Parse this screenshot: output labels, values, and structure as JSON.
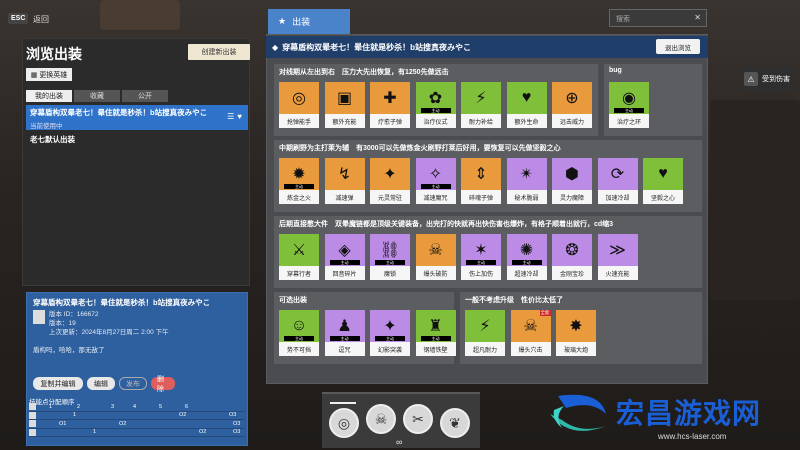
{
  "top_left": {
    "esc": "ESC",
    "back": "返回"
  },
  "left": {
    "title": "浏览出装",
    "create_btn": "创建新出装",
    "switch_hero": "更换英雄",
    "tabs": [
      "我的出装",
      "收藏",
      "公开"
    ],
    "active_loadout": {
      "title": "穿幕盾构双晕老七！晕住就是秒杀！b站搜真夜みやこ",
      "status": "当前使用中"
    },
    "default_loadout": "老七默认出装"
  },
  "detail": {
    "title": "穿幕盾构双晕老七！晕住就是秒杀！b站搜真夜みやこ",
    "meta": [
      "版本 ID：166672",
      "版本：19",
      "上次更新：2024年8月27日周二 2:00 下午"
    ],
    "desc": "盾构吗，哈哈，那无敌了",
    "buttons": {
      "copy_edit": "复制并编辑",
      "edit": "编辑",
      "publish": "发布",
      "delete": "删除"
    },
    "skill_order_label": "技能点分配顺序",
    "skill_rows": [
      {
        "marks": [
          "1",
          "2",
          "3",
          "4",
          "5",
          "6"
        ]
      },
      {
        "marks": [
          "1",
          "O2",
          "O3"
        ]
      },
      {
        "marks": [
          "O1",
          "O2",
          "O3"
        ]
      },
      {
        "marks": [
          "1",
          "O2",
          "O3"
        ]
      }
    ]
  },
  "main": {
    "tab_label": "出装",
    "search_placeholder": "搜索",
    "search_close": "✕",
    "header_title": "穿幕盾构双晕老七！晕住就是秒杀！b站搜真夜みやこ",
    "exit_browse": "退出浏览",
    "active_tag": "主动",
    "sections": [
      {
        "title": "对线期从左出到右　压力大先出恢复，有1250先做远击",
        "items": [
          {
            "name": "抢弹能手",
            "color": "orange",
            "icon": "◎"
          },
          {
            "name": "额外充能",
            "color": "orange",
            "icon": "▣"
          },
          {
            "name": "疗愈子弹",
            "color": "orange",
            "icon": "✚"
          },
          {
            "name": "治疗仪式",
            "color": "green",
            "icon": "✿",
            "active": true
          },
          {
            "name": "耐力补给",
            "color": "green",
            "icon": "⚡"
          },
          {
            "name": "额外生命",
            "color": "green",
            "icon": "♥"
          },
          {
            "name": "远击威力",
            "color": "orange",
            "icon": "⊕"
          }
        ]
      },
      {
        "title": "bug",
        "items": [
          {
            "name": "治疗之环",
            "color": "green",
            "icon": "◉",
            "active": true
          }
        ]
      },
      {
        "title": "中期刷野为主打莱为辅　有3000可以先做炼金火刷野打莱后好用，要恢复可以先做坚毅之心",
        "items": [
          {
            "name": "炼金之火",
            "color": "orange",
            "icon": "✹",
            "active": true
          },
          {
            "name": "减速弹",
            "color": "orange",
            "icon": "↯"
          },
          {
            "name": "元灵常驻",
            "color": "orange",
            "icon": "✦"
          },
          {
            "name": "减速魔咒",
            "color": "purple",
            "icon": "✧",
            "active": true
          },
          {
            "name": "碎魂子弹",
            "color": "orange",
            "icon": "⇕"
          },
          {
            "name": "秘术脆弱",
            "color": "purple",
            "icon": "✴"
          },
          {
            "name": "灵力魔障",
            "color": "purple",
            "icon": "⬢"
          },
          {
            "name": "加速冷却",
            "color": "purple",
            "icon": "⟳"
          },
          {
            "name": "坚毅之心",
            "color": "green",
            "icon": "♥"
          }
        ]
      },
      {
        "title": "后期直接憋大件　双晕魔链都是顶级关键装备，出完打的快就再出快伤害也爆炸，有格子顺着出就行，cd缩3",
        "items": [
          {
            "name": "穿幕行者",
            "color": "green",
            "icon": "⚔"
          },
          {
            "name": "回音碎片",
            "color": "purple",
            "icon": "◈",
            "active": true
          },
          {
            "name": "魔锁",
            "color": "purple",
            "icon": "⛓",
            "active": true
          },
          {
            "name": "爆头破防",
            "color": "orange",
            "icon": "☠"
          },
          {
            "name": "伤上加伤",
            "color": "purple",
            "icon": "✶",
            "active": true
          },
          {
            "name": "超速冷却",
            "color": "purple",
            "icon": "✺",
            "active": true
          },
          {
            "name": "金刚宝珍",
            "color": "purple",
            "icon": "❂"
          },
          {
            "name": "火速充能",
            "color": "purple",
            "icon": "≫"
          }
        ]
      },
      {
        "title": "可选出装",
        "items": [
          {
            "name": "势不可挡",
            "color": "green",
            "icon": "☺",
            "active": true
          },
          {
            "name": "逗咒",
            "color": "purple",
            "icon": "♟",
            "active": true
          },
          {
            "name": "幻影突袭",
            "color": "purple",
            "icon": "✦",
            "active": true
          },
          {
            "name": "钢墙铁壁",
            "color": "green",
            "icon": "♜",
            "active": true
          }
        ]
      },
      {
        "title": "一般不考虑升级　性价比太低了",
        "items": [
          {
            "name": "超凡耐力",
            "color": "green",
            "icon": "⚡"
          },
          {
            "name": "爆头穴击",
            "color": "orange",
            "icon": "☠",
            "corner": "全能"
          },
          {
            "name": "玻璃大炮",
            "color": "orange",
            "icon": "✸"
          }
        ]
      }
    ]
  },
  "damage_widget": {
    "label": "受到伤害"
  },
  "watermark": {
    "title": "宏昌游戏网",
    "url": "www.hcs-laser.com"
  }
}
